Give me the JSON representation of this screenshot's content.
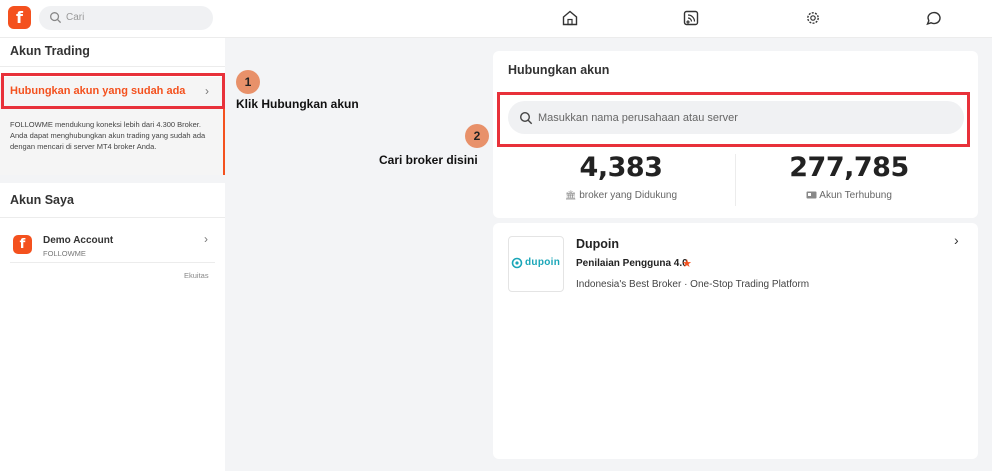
{
  "topbar": {
    "logo_letter": "f",
    "search_placeholder": "Cari",
    "nav_icons": [
      "home-icon",
      "feed-icon",
      "settings-icon",
      "chat-icon"
    ]
  },
  "sidebar": {
    "trading_title": "Akun Trading",
    "connect_label": "Hubungkan akun yang sudah ada",
    "connect_desc": "FOLLOWME mendukung koneksi lebih dari 4.300 Broker. Anda dapat menghubungkan akun trading yang sudah ada dengan mencari di server MT4 broker Anda.",
    "my_accounts_title": "Akun Saya",
    "account": {
      "name": "Demo Account",
      "sub": "FOLLOWME",
      "equity_label": "Ekuitas"
    }
  },
  "annotations": {
    "step1_num": "1",
    "step1_text": "Klik Hubungkan akun",
    "step2_num": "2",
    "step2_text": "Cari broker disini"
  },
  "main": {
    "title": "Hubungkan akun",
    "search_placeholder": "Masukkan nama perusahaan atau server",
    "stats": [
      {
        "value": "4,383",
        "label": "broker yang Didukung",
        "icon": "bank-icon"
      },
      {
        "value": "277,785",
        "label": "Akun Terhubung",
        "icon": "id-card-icon"
      }
    ],
    "broker": {
      "logo_text": "dupoin",
      "name": "Dupoin",
      "rating": "Penilaian Pengguna 4.0",
      "desc": "Indonesia's Best Broker · One-Stop Trading Platform"
    }
  },
  "colors": {
    "accent": "#f4511e",
    "highlight_box": "#e8313a",
    "badge": "#e8916a"
  }
}
